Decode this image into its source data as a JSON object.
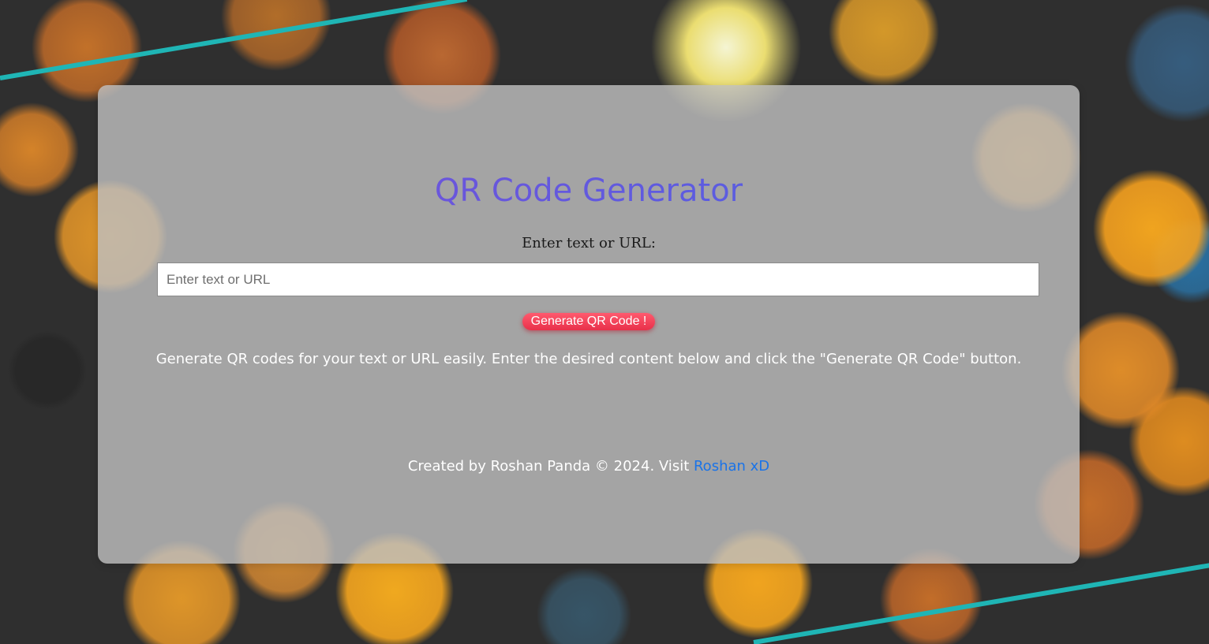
{
  "page": {
    "title": "QR Code Generator",
    "input_label": "Enter text or URL:",
    "input_placeholder": "Enter text or URL",
    "input_value": "",
    "button_label": "Generate QR Code !",
    "description": "Generate QR codes for your text or URL easily. Enter the desired content below and click the \"Generate QR Code\" button."
  },
  "footer": {
    "text": "Created by Roshan Panda © 2024. Visit ",
    "link_label": "Roshan xD"
  },
  "colors": {
    "title_gradient_start": "#7b4fd6",
    "title_gradient_end": "#4a63e6",
    "button": "#f23a52",
    "link": "#1a73e8",
    "stripe": "#1fb5b5"
  }
}
